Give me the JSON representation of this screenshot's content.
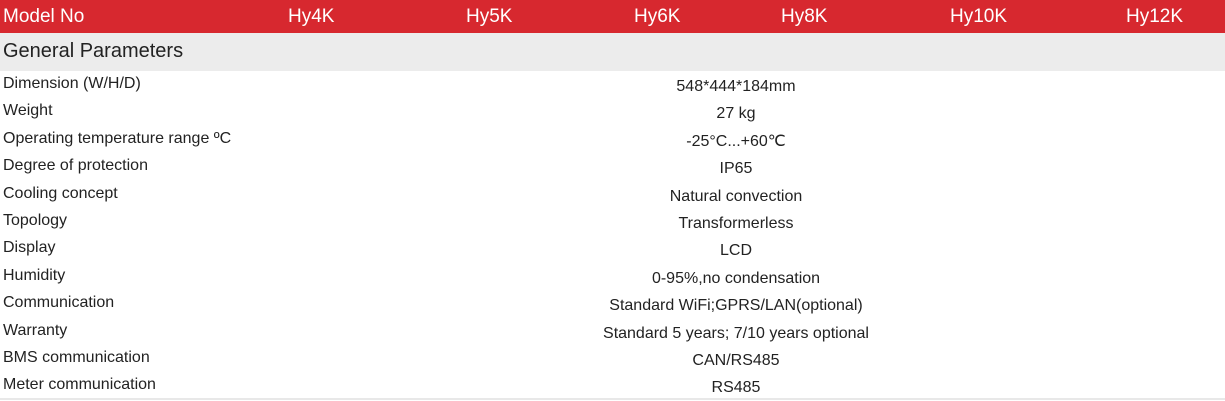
{
  "header": {
    "label": "Model No",
    "models": [
      "Hy4K",
      "Hy5K",
      "Hy6K",
      "Hy8K",
      "Hy10K",
      "Hy12K"
    ]
  },
  "section_title": "General Parameters",
  "rows": [
    {
      "label": "Dimension (W/H/D)",
      "value": "548*444*184mm"
    },
    {
      "label": "Weight",
      "value": "27 kg"
    },
    {
      "label": "Operating temperature range ºC",
      "value": "-25°C...+60℃"
    },
    {
      "label": "Degree of protection",
      "value": "IP65"
    },
    {
      "label": "Cooling concept",
      "value": "Natural convection"
    },
    {
      "label": "Topology",
      "value": "Transformerless"
    },
    {
      "label": "Display",
      "value": "LCD"
    },
    {
      "label": "Humidity",
      "value": "0-95%,no condensation"
    },
    {
      "label": "Communication",
      "value": "Standard WiFi;GPRS/LAN(optional)"
    },
    {
      "label": "Warranty",
      "value": "Standard 5 years; 7/10 years optional"
    },
    {
      "label": "BMS communication",
      "value": "CAN/RS485"
    },
    {
      "label": "Meter communication",
      "value": "RS485"
    }
  ],
  "colors": {
    "header_bg": "#d7282f",
    "section_bg": "#ececec"
  }
}
